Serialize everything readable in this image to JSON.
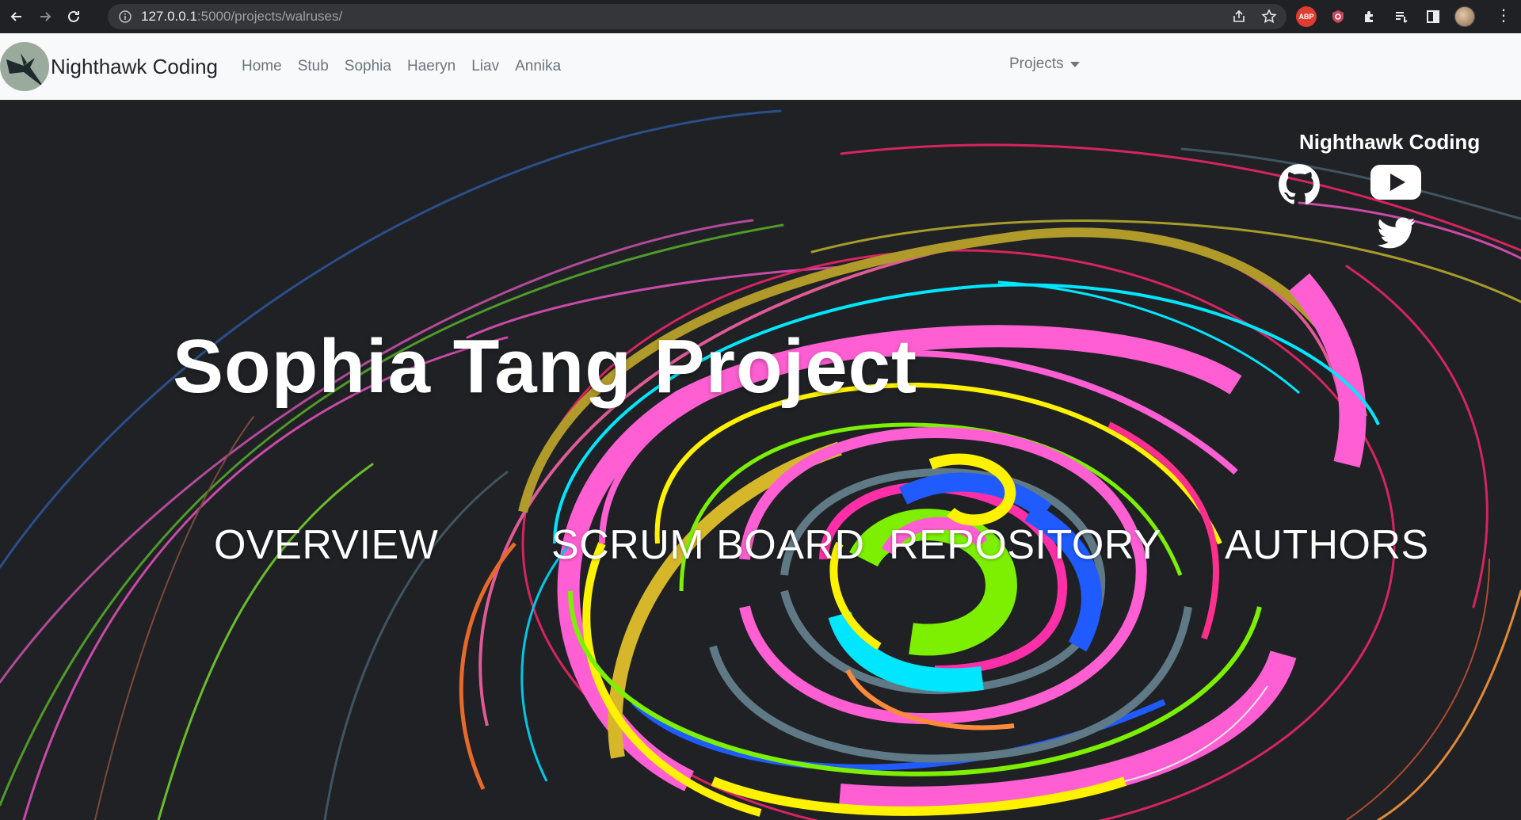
{
  "browser": {
    "url_host": "127.0.0.1",
    "url_rest": ":5000/projects/walruses/",
    "extensions": [
      "ABP"
    ]
  },
  "navbar": {
    "brand": "Nighthawk Coding",
    "links": [
      "Home",
      "Stub",
      "Sophia",
      "Haeryn",
      "Liav",
      "Annika"
    ],
    "dropdown": "Projects"
  },
  "hero": {
    "social_title": "Nighthawk Coding",
    "title": "Sophia Tang Project",
    "sections": [
      "OVERVIEW",
      "SCRUM BOARD",
      "REPOSITORY",
      "AUTHORS"
    ],
    "icons": [
      "github-icon",
      "youtube-icon",
      "twitter-icon"
    ]
  },
  "colors": {
    "hero_bg": "#1f2125",
    "navbar_bg": "#f8f9fa",
    "pink": "#ff5fd2",
    "yellow": "#fff200",
    "cyan": "#00e6ff",
    "green": "#7cf000",
    "blue": "#1f5bff"
  }
}
